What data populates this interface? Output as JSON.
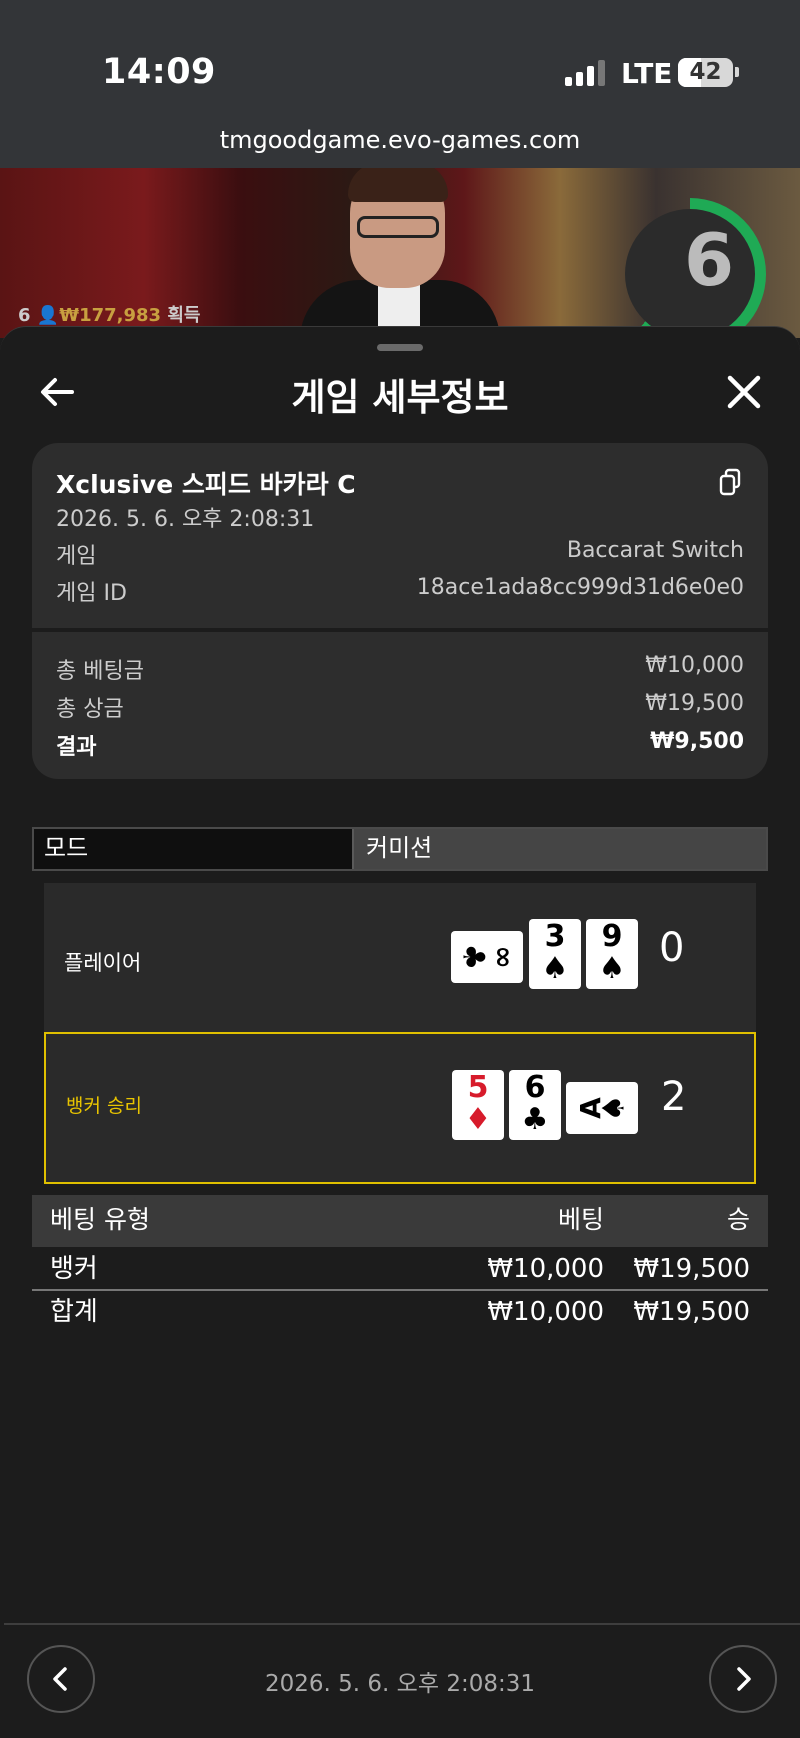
{
  "status_bar": {
    "time": "14:09",
    "network": "LTE",
    "battery": "42"
  },
  "browser": {
    "url": "tmgoodgame.evo-games.com"
  },
  "video": {
    "timer": "6",
    "win_count": "6",
    "win_amount": "₩177,983",
    "win_suffix": "획득"
  },
  "sheet": {
    "title": "게임 세부정보",
    "details": {
      "table_name": "Xclusive 스피드 바카라 C",
      "datetime": "2026. 5. 6. 오후 2:08:31",
      "game_label": "게임",
      "game_value": "Baccarat Switch",
      "game_id_label": "게임 ID",
      "game_id_value": "18ace1ada8cc999d31d6e0e0",
      "total_bet_label": "총 베팅금",
      "total_bet_value": "₩10,000",
      "total_payout_label": "총 상금",
      "total_payout_value": "₩19,500",
      "result_label": "결과",
      "result_value": "₩9,500"
    },
    "mode": {
      "label": "모드",
      "value": "커미션"
    },
    "hands": {
      "player": {
        "label": "플레이어",
        "score": "0",
        "cards": [
          {
            "rank": "∞",
            "suit": "♣",
            "color": "#000000",
            "orientation": "side-left"
          },
          {
            "rank": "3",
            "suit": "♠",
            "color": "#000000",
            "orientation": "up"
          },
          {
            "rank": "9",
            "suit": "♠",
            "color": "#000000",
            "orientation": "up"
          }
        ]
      },
      "banker": {
        "label": "뱅커 승리",
        "score": "2",
        "cards": [
          {
            "rank": "5",
            "suit": "♦",
            "color": "#d71b2b",
            "orientation": "up"
          },
          {
            "rank": "6",
            "suit": "♣",
            "color": "#000000",
            "orientation": "up"
          },
          {
            "rank": "A",
            "suit": "♠",
            "color": "#000000",
            "orientation": "side-right"
          }
        ]
      }
    },
    "bets_table": {
      "headers": {
        "type": "베팅 유형",
        "bet": "베팅",
        "win": "승"
      },
      "rows": [
        {
          "type": "뱅커",
          "bet": "₩10,000",
          "win": "₩19,500"
        }
      ],
      "total": {
        "type": "합계",
        "bet": "₩10,000",
        "win": "₩19,500"
      }
    },
    "footer": {
      "datetime": "2026. 5. 6. 오후 2:08:31"
    }
  },
  "colors": {
    "accent_gold": "#e8c400",
    "timer_green": "#1faa55",
    "card_red": "#d71b2b"
  }
}
